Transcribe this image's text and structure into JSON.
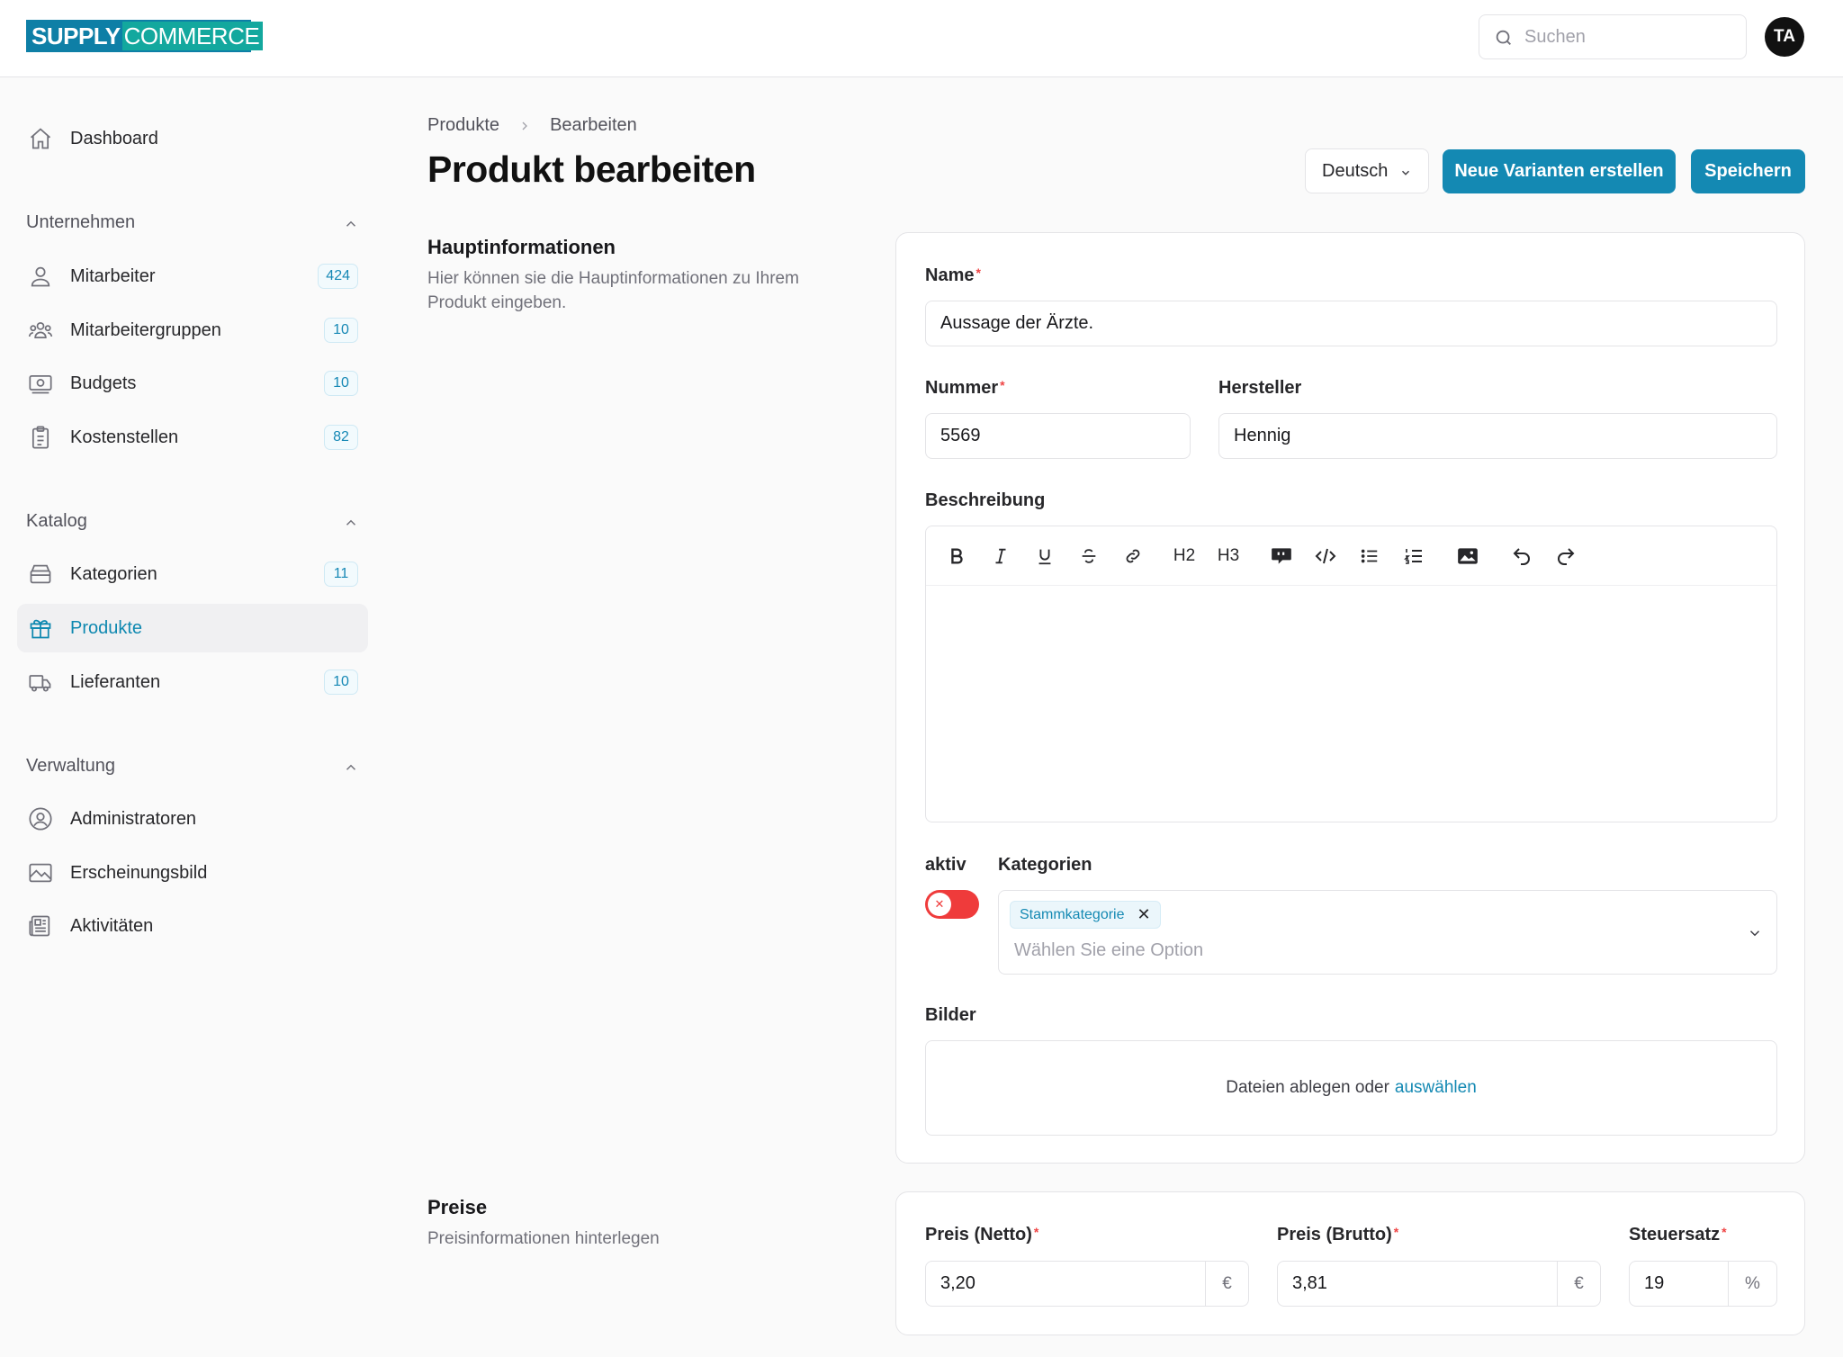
{
  "header": {
    "logo_part1": "SUPPLY",
    "logo_part2": "COMMERCE",
    "search_placeholder": "Suchen",
    "avatar_initials": "TA"
  },
  "sidebar": {
    "dashboard": "Dashboard",
    "sections": [
      {
        "title": "Unternehmen",
        "items": [
          {
            "label": "Mitarbeiter",
            "badge": "424",
            "icon": "user-icon"
          },
          {
            "label": "Mitarbeitergruppen",
            "badge": "10",
            "icon": "users-icon"
          },
          {
            "label": "Budgets",
            "badge": "10",
            "icon": "money-icon"
          },
          {
            "label": "Kostenstellen",
            "badge": "82",
            "icon": "clipboard-icon"
          }
        ]
      },
      {
        "title": "Katalog",
        "items": [
          {
            "label": "Kategorien",
            "badge": "11",
            "icon": "tray-icon"
          },
          {
            "label": "Produkte",
            "badge": "",
            "icon": "gift-icon",
            "active": true
          },
          {
            "label": "Lieferanten",
            "badge": "10",
            "icon": "truck-icon"
          }
        ]
      },
      {
        "title": "Verwaltung",
        "items": [
          {
            "label": "Administratoren",
            "badge": "",
            "icon": "user-circle-icon"
          },
          {
            "label": "Erscheinungsbild",
            "badge": "",
            "icon": "image-icon"
          },
          {
            "label": "Aktivitäten",
            "badge": "",
            "icon": "newspaper-icon"
          }
        ]
      }
    ]
  },
  "breadcrumb": [
    "Produkte",
    "Bearbeiten"
  ],
  "page_title": "Produkt bearbeiten",
  "actions": {
    "language": "Deutsch",
    "new_variants": "Neue Varianten erstellen",
    "save": "Speichern"
  },
  "main_info": {
    "heading": "Hauptinformationen",
    "description": "Hier können sie die Hauptinformationen zu Ihrem Produkt eingeben.",
    "name_label": "Name",
    "name_value": "Aussage der Ärzte.",
    "number_label": "Nummer",
    "number_value": "5569",
    "manufacturer_label": "Hersteller",
    "manufacturer_value": "Hennig",
    "description_label": "Beschreibung",
    "toolbar": {
      "h2": "H2",
      "h3": "H3"
    },
    "active_label": "aktiv",
    "active": false,
    "categories_label": "Kategorien",
    "category_chip": "Stammkategorie",
    "categories_placeholder": "Wählen Sie eine Option",
    "images_label": "Bilder",
    "dropzone_text": "Dateien ablegen oder",
    "dropzone_link": "auswählen"
  },
  "prices": {
    "heading": "Preise",
    "description": "Preisinformationen hinterlegen",
    "net_label": "Preis (Netto)",
    "net_value": "3,20",
    "net_suffix": "€",
    "gross_label": "Preis (Brutto)",
    "gross_value": "3,81",
    "gross_suffix": "€",
    "tax_label": "Steuersatz",
    "tax_value": "19",
    "tax_suffix": "%"
  },
  "colors": {
    "primary": "#1489b3",
    "toggle_off": "#ef3b3b",
    "required": "#ef4444"
  }
}
